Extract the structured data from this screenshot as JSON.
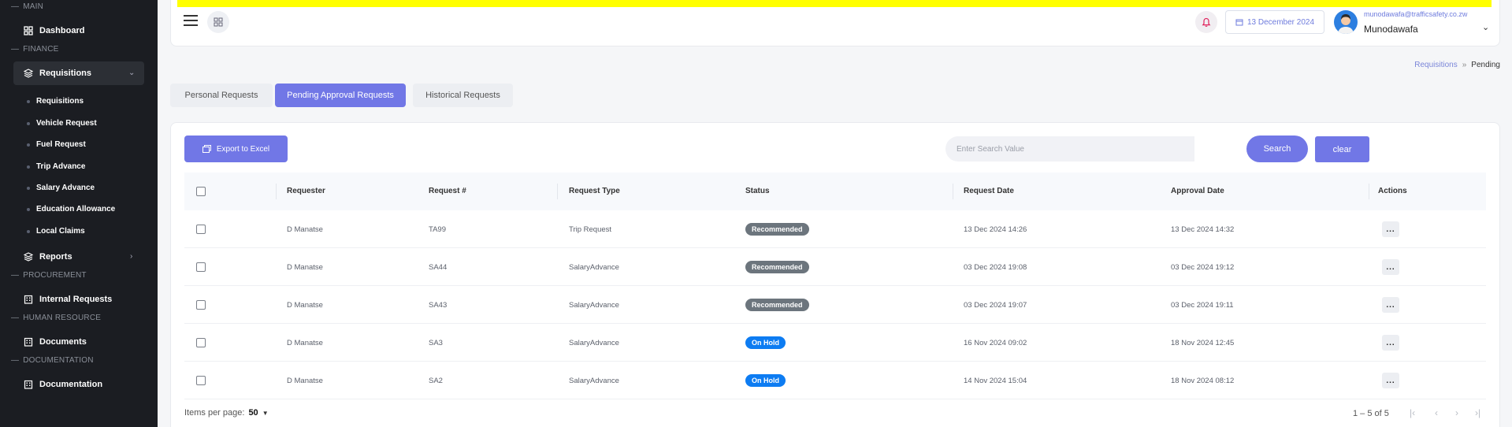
{
  "sidebar": {
    "sections": [
      {
        "label": "MAIN"
      },
      {
        "label": "FINANCE"
      },
      {
        "label": "PROCUREMENT"
      },
      {
        "label": "HUMAN RESOURCE"
      },
      {
        "label": "DOCUMENTATION"
      }
    ],
    "items": {
      "dashboard": "Dashboard",
      "requisitions": "Requisitions",
      "reports": "Reports",
      "internal_requests": "Internal Requests",
      "documents": "Documents",
      "documentation": "Documentation"
    },
    "sub_items": [
      {
        "label": "Requisitions"
      },
      {
        "label": "Vehicle Request"
      },
      {
        "label": "Fuel Request"
      },
      {
        "label": "Trip Advance"
      },
      {
        "label": "Salary Advance"
      },
      {
        "label": "Education Allowance"
      },
      {
        "label": "Local Claims"
      }
    ]
  },
  "header": {
    "date": "13 December 2024",
    "user_email": "munodawafa@trafficsafety.co.zw",
    "user_name": "Munodawafa"
  },
  "breadcrumb": {
    "parent": "Requisitions",
    "separator": "»",
    "current": "Pending"
  },
  "tabs": [
    {
      "label": "Personal Requests"
    },
    {
      "label": "Pending Approval Requests"
    },
    {
      "label": "Historical Requests"
    }
  ],
  "toolbar": {
    "export_label": "Export to Excel",
    "search_placeholder": "Enter Search Value",
    "search_label": "Search",
    "clear_label": "clear"
  },
  "table": {
    "columns": {
      "requester": "Requester",
      "request_no": "Request #",
      "request_type": "Request Type",
      "status": "Status",
      "request_date": "Request Date",
      "approval_date": "Approval Date",
      "actions": "Actions"
    },
    "rows": [
      {
        "requester": "D Manatse",
        "request_no": "TA99",
        "request_type": "Trip Request",
        "status": "Recommended",
        "request_date": "13 Dec 2024 14:26",
        "approval_date": "13 Dec 2024 14:32",
        "action": "..."
      },
      {
        "requester": "D Manatse",
        "request_no": "SA44",
        "request_type": "SalaryAdvance",
        "status": "Recommended",
        "request_date": "03 Dec 2024 19:08",
        "approval_date": "03 Dec 2024 19:12",
        "action": "..."
      },
      {
        "requester": "D Manatse",
        "request_no": "SA43",
        "request_type": "SalaryAdvance",
        "status": "Recommended",
        "request_date": "03 Dec 2024 19:07",
        "approval_date": "03 Dec 2024 19:11",
        "action": "..."
      },
      {
        "requester": "D Manatse",
        "request_no": "SA3",
        "request_type": "SalaryAdvance",
        "status": "On Hold",
        "request_date": "16 Nov 2024 09:02",
        "approval_date": "18 Nov 2024 12:45",
        "action": "..."
      },
      {
        "requester": "D Manatse",
        "request_no": "SA2",
        "request_type": "SalaryAdvance",
        "status": "On Hold",
        "request_date": "14 Nov 2024 15:04",
        "approval_date": "18 Nov 2024 08:12",
        "action": "..."
      }
    ]
  },
  "pagination": {
    "items_per_page_label": "Items per page:",
    "items_per_page_value": "50",
    "range": "1 – 5 of 5"
  },
  "colors": {
    "accent": "#7177e6",
    "sidebar_bg": "#1b1d22",
    "status_recommended": "#6c757d",
    "status_on_hold": "#0d7cf2",
    "banner": "#ffff00"
  }
}
